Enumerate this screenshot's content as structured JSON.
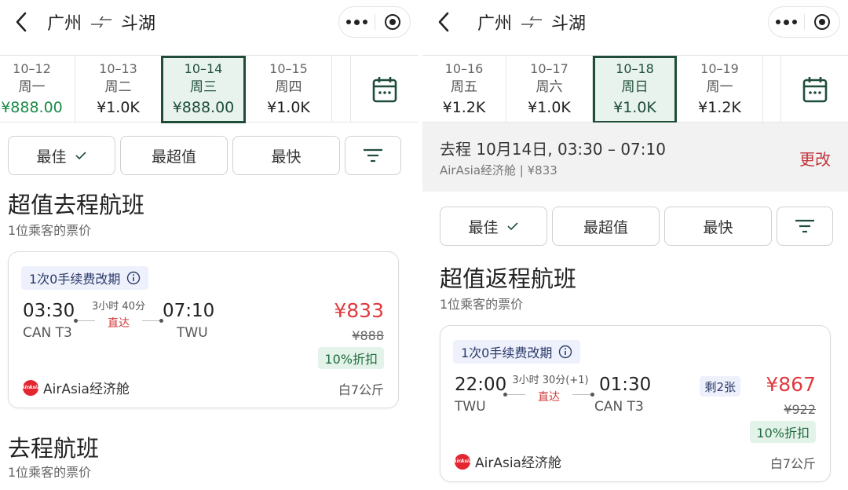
{
  "left": {
    "header": {
      "from": "广州",
      "to": "斗湖"
    },
    "dates": [
      {
        "date": "10–12",
        "weekday": "周一",
        "price": "¥888.00",
        "color": "green"
      },
      {
        "date": "10–13",
        "weekday": "周二",
        "price": "¥1.0K"
      },
      {
        "date": "10–14",
        "weekday": "周三",
        "price": "¥888.00",
        "selected": true
      },
      {
        "date": "10–15",
        "weekday": "周四",
        "price": "¥1.0K"
      }
    ],
    "sort": {
      "best": "最佳",
      "value": "最超值",
      "fastest": "最快"
    },
    "section_title": "超值去程航班",
    "section_sub": "1位乘客的票价",
    "card": {
      "tag": "1次0手续费改期",
      "dep_time": "03:30",
      "dep_airport": "CAN T3",
      "duration": "3小时 40分",
      "direct": "直达",
      "arr_time": "07:10",
      "arr_airport": "TWU",
      "price": "¥833",
      "old_price": "¥888",
      "discount": "10%折扣",
      "airline": "AirAsia经济舱",
      "baggage": "白7公斤"
    },
    "section2_title": "去程航班",
    "section2_sub": "1位乘客的票价"
  },
  "right": {
    "header": {
      "from": "广州",
      "to": "斗湖"
    },
    "dates": [
      {
        "date": "10–16",
        "weekday": "周五",
        "price": "¥1.2K"
      },
      {
        "date": "10–17",
        "weekday": "周六",
        "price": "¥1.0K"
      },
      {
        "date": "10–18",
        "weekday": "周日",
        "price": "¥1.0K",
        "selected": true
      },
      {
        "date": "10–19",
        "weekday": "周一",
        "price": "¥1.2K"
      }
    ],
    "summary": {
      "line1": "去程 10月14日, 03:30 – 07:10",
      "line2": "AirAsia经济舱 | ¥833",
      "change": "更改"
    },
    "sort": {
      "best": "最佳",
      "value": "最超值",
      "fastest": "最快"
    },
    "section_title": "超值返程航班",
    "section_sub": "1位乘客的票价",
    "card": {
      "tag": "1次0手续费改期",
      "dep_time": "22:00",
      "dep_airport": "TWU",
      "duration": "3小时 30分(+1)",
      "direct": "直达",
      "arr_time": "01:30",
      "arr_airport": "CAN T3",
      "seats_left": "剩2张",
      "price": "¥867",
      "old_price": "¥922",
      "discount": "10%折扣",
      "airline": "AirAsia经济舱",
      "baggage": "白7公斤"
    }
  },
  "colors": {
    "selected_border": "#1f4d3a",
    "price_red": "#e0393e",
    "discount_green": "#1d6b3e"
  },
  "icons": [
    "back-arrow-icon",
    "swap-arrows-icon",
    "more-dots-icon",
    "target-icon",
    "calendar-icon",
    "check-icon",
    "filter-icon",
    "info-icon",
    "airasia-logo-icon"
  ]
}
